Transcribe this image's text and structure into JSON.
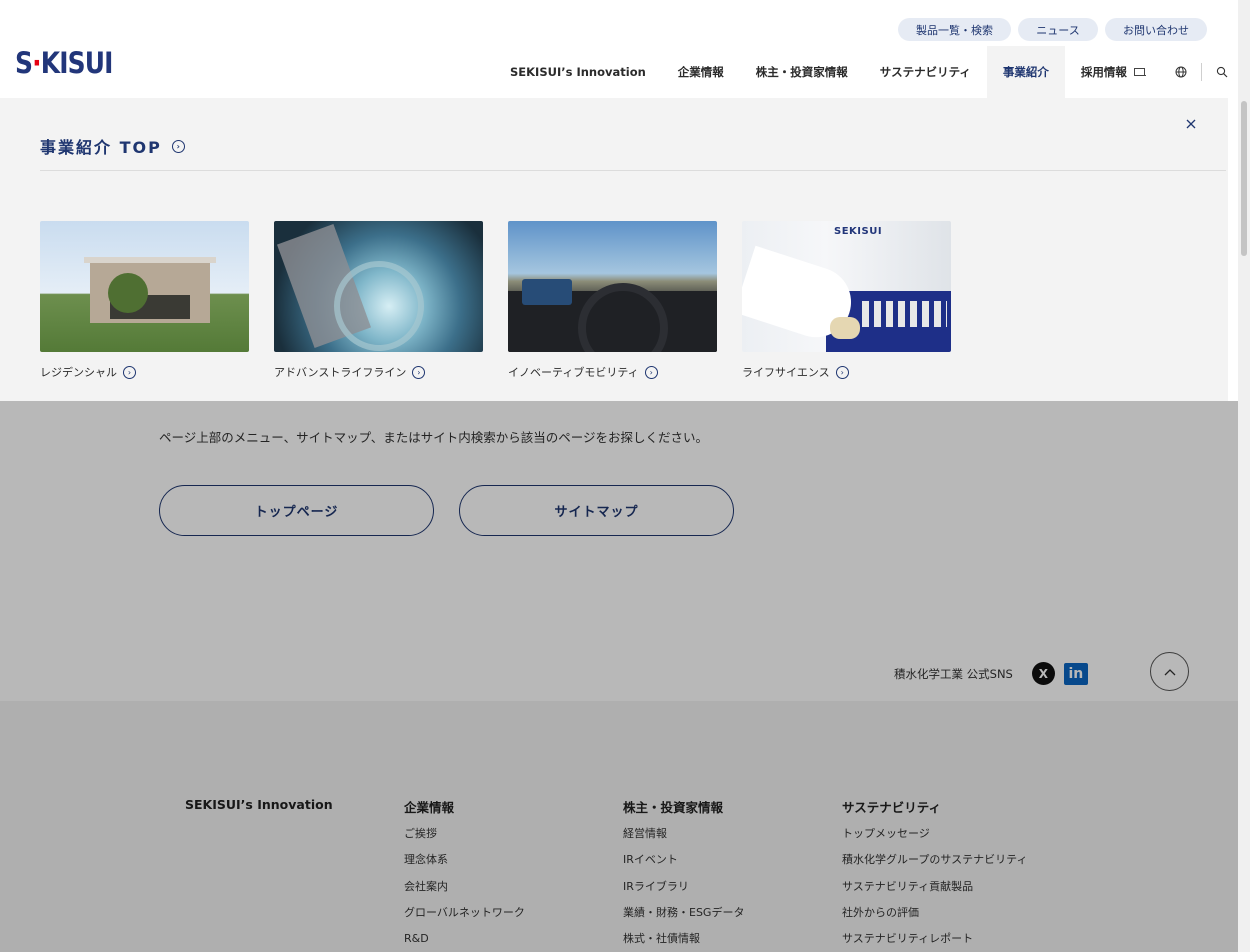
{
  "header": {
    "logo_text": "SEKISUI",
    "util_nav": [
      "製品一覧・検索",
      "ニュース",
      "お問い合わせ"
    ],
    "main_nav": [
      "SEKISUI’s Innovation",
      "企業情報",
      "株主・投資家情報",
      "サステナビリティ",
      "事業紹介",
      "採用情報"
    ],
    "active_nav": "事業紹介"
  },
  "mega": {
    "title": "事業紹介 TOP",
    "cards": [
      {
        "label": "レジデンシャル"
      },
      {
        "label": "アドバンストライフライン"
      },
      {
        "label": "イノベーティブモビリティ"
      },
      {
        "label": "ライフサイエンス"
      }
    ],
    "card_image_text": "SEKISUI"
  },
  "page": {
    "notice": "ページ上部のメニュー、サイトマップ、またはサイト内検索から該当のページをお探しください。",
    "btn_top": "トップページ",
    "btn_sitemap": "サイトマップ",
    "sns_label": "積水化学工業 公式SNS",
    "sns_x": "X",
    "sns_linkedin": "in"
  },
  "footer": {
    "col1": {
      "head": "SEKISUI’s Innovation",
      "links": []
    },
    "col2": {
      "head": "企業情報",
      "links": [
        "ご挨拶",
        "理念体系",
        "会社案内",
        "グローバルネットワーク",
        "R&D"
      ]
    },
    "col3": {
      "head": "株主・投資家情報",
      "links": [
        "経営情報",
        "IRイベント",
        "IRライブラリ",
        "業績・財務・ESGデータ",
        "株式・社債情報"
      ]
    },
    "col4": {
      "head": "サステナビリティ",
      "links": [
        "トップメッセージ",
        "積水化学グループのサステナビリティ",
        "サステナビリティ貢献製品",
        "社外からの評価",
        "サステナビリティレポート"
      ]
    }
  },
  "colors": {
    "brand_navy": "#1f3670",
    "brand_red": "#e60012",
    "pill_bg": "#e6ebf4"
  },
  "icons": [
    "globe-icon",
    "search-icon",
    "close-icon",
    "external-window-icon",
    "circle-arrow-icon",
    "x-logo-icon",
    "linkedin-icon",
    "chevron-up-icon"
  ]
}
